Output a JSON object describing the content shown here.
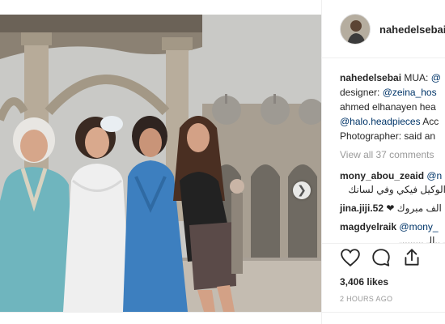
{
  "post": {
    "username": "nahedelsebai",
    "caption": {
      "line1_prefix": "MUA: ",
      "line1_mention": "@",
      "line2_prefix": "designer: ",
      "line2_mention": "@zeina_hos",
      "line3": "ahmed elhanayen hea",
      "line4_mention": "@halo.headpieces",
      "line4_suffix": " Acc",
      "line5": "Photographer: said an"
    },
    "view_all_comments": "View all 37 comments"
  },
  "comments": [
    {
      "username": "mony_abou_zeaid",
      "text": "@n"
    },
    {
      "username": "",
      "text": "الوكيل فيكي وفي لسانك"
    },
    {
      "username": "jina.jiji.52",
      "text": "الف مبروك ❤"
    },
    {
      "username": "magdyelraik",
      "text": "@mony_"
    },
    {
      "username": "",
      "text": "ـ ..الـ ........ـ"
    }
  ],
  "likes": "3,406 likes",
  "timestamp": "2 HOURS AGO",
  "icons": {
    "like": "heart-icon",
    "comment": "comment-icon",
    "share": "share-icon",
    "next": "chevron-right-icon"
  },
  "colors": {
    "mention": "#003569",
    "muted": "#999999",
    "text": "#262626"
  }
}
